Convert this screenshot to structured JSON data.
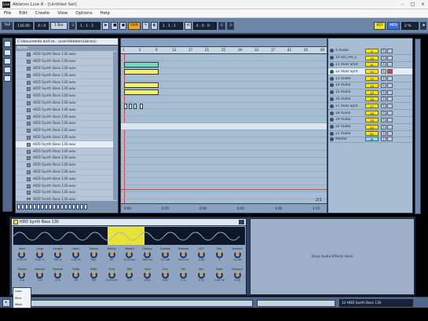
{
  "window": {
    "title": "Ableton Live 8 - [Untitled Set]"
  },
  "menu": [
    "File",
    "Edit",
    "Create",
    "View",
    "Options",
    "Help"
  ],
  "control": {
    "tap": "TAP",
    "tempo": "116.00",
    "sig": "4 / 4",
    "quant": "1 Bar",
    "position": "1 . 1 . 1",
    "ovr": "OVR",
    "loop_start": "1 . 1 . 1",
    "loop_len": "4 . 0 . 0",
    "key": "KEY",
    "midi": "MIDI",
    "cpu": "2 %"
  },
  "browser": {
    "path": "C:\\documents and se...\\user\\Ableton\\Library\\",
    "col_header": "Name",
    "items": [
      "HDD Synth Bass 130.wav",
      "HDD Synth Bass 130.wav",
      "HDD Synth Bass 130.wav",
      "HDD Synth Bass 130.wav",
      "HDD Synth Bass 130.wav",
      "HDD Synth Bass 130.wav",
      "HDD Synth Bass 130.wav",
      "HDD Synth Bass 130.wav",
      "HDD Synth Bass 130.wav",
      "HDD Synth Bass 130.wav",
      "HDD Synth Bass 130.wav",
      "HDD Synth Bass 130.wav",
      "HDD Synth Bass 130.wav",
      "HDD Synth Bass 130.wav",
      "HDD Synth Bass 130.wav",
      "HDD Synth Bass 130.wav",
      "HDD Synth Bass 130.wav",
      "HDD Synth Bass 130.wav",
      "HDD Synth Bass 130.wav",
      "HDD Synth Bass 130.wav",
      "HDD Synth Bass 130.wav",
      "HDD Synth Bass 130.wav"
    ],
    "selected_index": 13
  },
  "arrangement": {
    "ruler": [
      "1",
      "5",
      "9",
      "13",
      "17",
      "21",
      "25",
      "29",
      "33",
      "37",
      "41",
      "45",
      "49"
    ],
    "bottom": [
      "0:00",
      "0:15",
      "0:30",
      "0:45",
      "1:00",
      "1:15"
    ],
    "zoom": "2/1"
  },
  "tracks": [
    {
      "name": "9 Audio",
      "num": "9"
    },
    {
      "name": "10 DD_HH_L",
      "num": "10"
    },
    {
      "name": "11 HDD Shut",
      "num": "11"
    },
    {
      "name": "12 HDD Synt",
      "num": "12",
      "selected": true
    },
    {
      "name": "13 Audio",
      "num": "13"
    },
    {
      "name": "14 Audio",
      "num": "14"
    },
    {
      "name": "15 Audio",
      "num": "15"
    },
    {
      "name": "16 Audio",
      "num": "16"
    },
    {
      "name": "17 HDD Synt",
      "num": "17"
    },
    {
      "name": "18 Audio",
      "num": "18"
    },
    {
      "name": "19 Audio",
      "num": "19"
    },
    {
      "name": "20 Audio",
      "num": "20"
    },
    {
      "name": "21 Audio",
      "num": "21"
    },
    {
      "name": "Master",
      "num": "M",
      "master": true
    }
  ],
  "device": {
    "title": "HDD Synth Bass 130",
    "row1": [
      {
        "l": "Start",
        "v": "0.00 %"
      },
      {
        "l": "Loop",
        "v": "0.00 %"
      },
      {
        "l": "Length",
        "v": "100 %"
      },
      {
        "l": "Fade",
        "v": "0.00 %"
      },
      {
        "l": "Voices",
        "v": "Poly"
      },
      {
        "l": "Retrig",
        "v": "On"
      },
      {
        "l": "Attack",
        "v": "0.00 ms"
      },
      {
        "l": "Decay",
        "v": "600 ms"
      },
      {
        "l": "Sustain",
        "v": "0.0 dB"
      },
      {
        "l": "Release",
        "v": "50.0 ms"
      },
      {
        "l": "LFO",
        "v": "0.00"
      },
      {
        "l": "Pan",
        "v": "C"
      },
      {
        "l": "Volume",
        "v": "-12 dB"
      }
    ],
    "row2": [
      {
        "l": "Transp",
        "v": "0 st"
      },
      {
        "l": "Detune",
        "v": "0 ct"
      },
      {
        "l": "Spread",
        "v": "0 %"
      },
      {
        "l": "Glide",
        "v": "Off"
      },
      {
        "l": "Filter",
        "v": "Off"
      },
      {
        "l": "Freq",
        "v": "22.0 kHz"
      },
      {
        "l": "Res",
        "v": "0.0"
      },
      {
        "l": "Type",
        "v": "LP12"
      },
      {
        "l": "Env",
        "v": "0.00"
      },
      {
        "l": "Vel",
        "v": "0 %"
      },
      {
        "l": "Key",
        "v": "0 %"
      },
      {
        "l": "Rate",
        "v": "1.00 Hz"
      },
      {
        "l": "Amount",
        "v": "0.00"
      }
    ]
  },
  "effects": {
    "drop": "Drop Audio Effects Here"
  },
  "status": {
    "track": "12-HDD Synth Bass 130"
  },
  "popup": [
    "Loop",
    "Slice",
    "Warp"
  ]
}
